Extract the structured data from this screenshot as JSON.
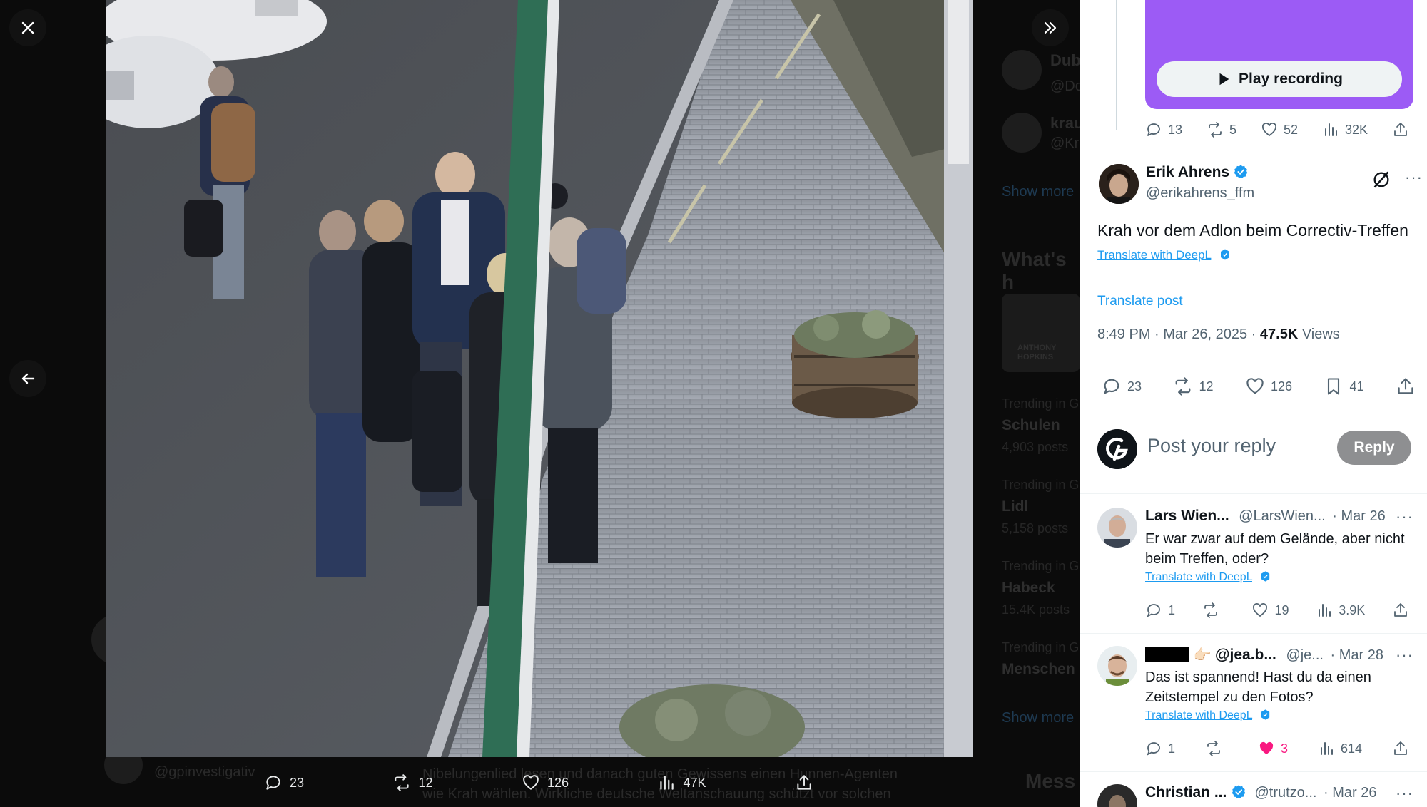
{
  "viewer": {
    "close_icon": "close-icon",
    "expand_icon": "double-chevron-right-icon",
    "back_icon": "arrow-left-icon",
    "actions": {
      "replies": "23",
      "reposts": "12",
      "likes": "126",
      "views": "47K"
    },
    "background_ghost": {
      "accounts": [
        "Dub",
        "@Do",
        "krau",
        "@Kr"
      ],
      "show_more": "Show more",
      "section_title": "What's h",
      "card_caption": "ANTHONY\nHOPKINS",
      "trends": [
        {
          "label": "Trending in G",
          "name": "Schulen",
          "posts": "4,903 posts"
        },
        {
          "label": "Trending in G",
          "name": "Lidl",
          "posts": "5,158 posts"
        },
        {
          "label": "Trending in G",
          "name": "Habeck",
          "posts": "15.4K posts"
        },
        {
          "label": "Trending in G",
          "name": "Menschen",
          "posts": ""
        }
      ],
      "show_more_2": "Show more",
      "messages": "Mess",
      "bottom_text_1": "Nibelungenlied lesen und danach guten Gewissens einen Hunnen-Agenten",
      "bottom_text_2": "wie Krah wählen. Wirkliche deutsche Weltanschauung schützt vor solchen",
      "bottom_handle": "@gpinvestigativ"
    }
  },
  "audio": {
    "play_label": "Play recording"
  },
  "prev_metrics": {
    "replies": "13",
    "reposts": "5",
    "likes": "52",
    "views": "32K"
  },
  "post": {
    "author_name": "Erik Ahrens",
    "author_handle": "@erikahrens_ffm",
    "text": "Krah vor dem Adlon beim Correctiv-Treffen",
    "deepl": "Translate with DeepL",
    "translate_post": "Translate post",
    "time": "8:49 PM · Mar 26, 2025 · ",
    "views_count": "47.5K",
    "views_label": " Views",
    "metrics": {
      "replies": "23",
      "reposts": "12",
      "likes": "126",
      "bookmarks": "41"
    }
  },
  "composer": {
    "placeholder": "Post your reply",
    "reply_label": "Reply"
  },
  "replies": [
    {
      "name": "Lars Wien...",
      "handle": "@LarsWien...",
      "date": "· Mar 26",
      "text": "Er war zwar auf dem Gelände, aber nicht beim Treffen, oder?",
      "deepl": "Translate with DeepL",
      "replies": "1",
      "reposts": "",
      "likes": "19",
      "views": "3.9K"
    },
    {
      "name": "@jea.b...",
      "handle": "@je...",
      "date": "· Mar 28",
      "text": "Das ist spannend! Hast du da einen Zeitstempel zu den Fotos?",
      "deepl": "Translate with DeepL",
      "replies": "1",
      "reposts": "",
      "likes": "3",
      "views": "614"
    },
    {
      "name": "Christian ...",
      "handle": "@trutzo...",
      "date": "· Mar 26"
    }
  ],
  "colors": {
    "accent": "#1d9bf0",
    "like_active": "#f91880",
    "audio_card": "#9c5bf5",
    "reply_button": "#8e8f91"
  }
}
